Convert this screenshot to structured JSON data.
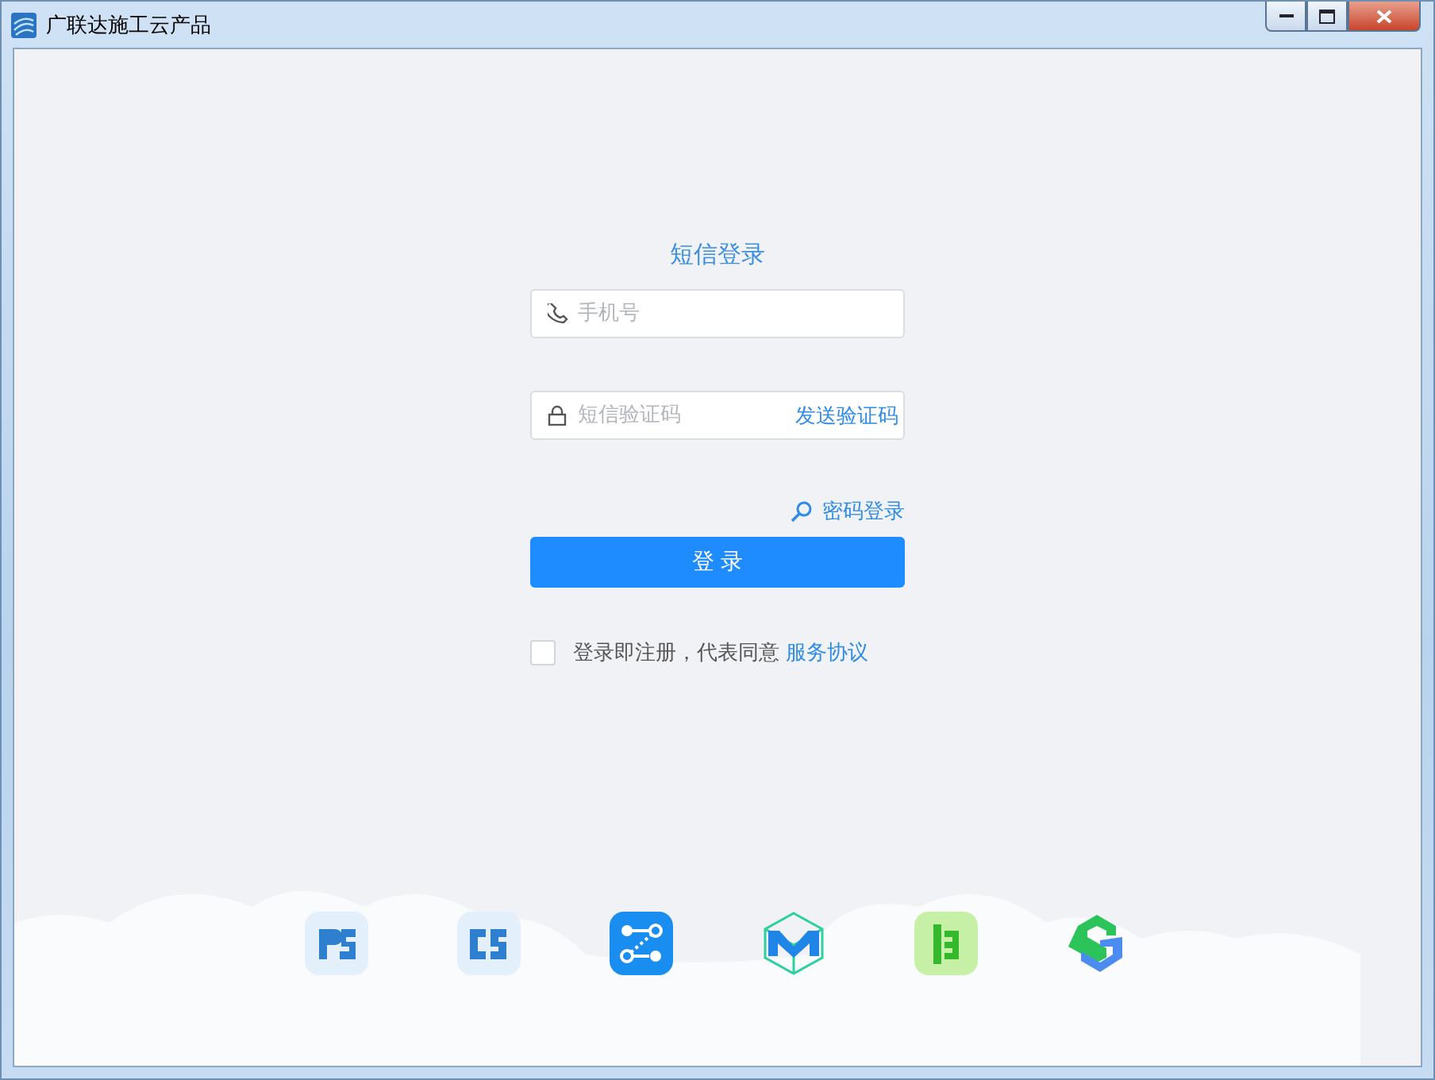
{
  "window": {
    "title": "广联达施工云产品"
  },
  "form": {
    "title": "短信登录",
    "phone": {
      "placeholder": "手机号"
    },
    "code": {
      "placeholder": "短信验证码",
      "action": "发送验证码"
    },
    "password_login": "密码登录",
    "login_button": "登 录",
    "agreement": {
      "checked": false,
      "text": "登录即注册，代表同意",
      "link": "服务协议"
    }
  },
  "products": [
    {
      "kind": "ps"
    },
    {
      "kind": "cs"
    },
    {
      "kind": "flow"
    },
    {
      "kind": "cube"
    },
    {
      "kind": "ladder"
    },
    {
      "kind": "hex"
    }
  ]
}
